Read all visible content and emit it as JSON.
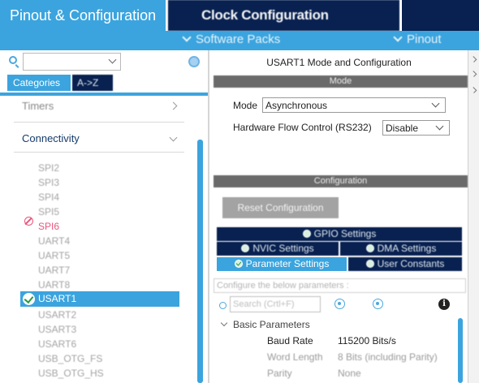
{
  "top_tabs": {
    "pinout": "Pinout & Configuration",
    "clock": "Clock Configuration"
  },
  "subbar": {
    "software_packs": "Software Packs",
    "pinout": "Pinout"
  },
  "left_panel": {
    "tabs": {
      "categories": "Categories",
      "atoz": "A->Z"
    },
    "tree": {
      "timers": "Timers",
      "connectivity": "Connectivity",
      "peripherals": [
        "SPI2",
        "SPI3",
        "SPI4",
        "SPI5",
        "SPI6",
        "UART4",
        "UART5",
        "UART7",
        "UART8",
        "USART1",
        "USART2",
        "USART3",
        "USART6",
        "USB_OTG_FS",
        "USB_OTG_HS"
      ],
      "selected": "USART1",
      "error_item": "SPI6"
    }
  },
  "right_panel": {
    "title": "USART1 Mode and Configuration",
    "mode_section": "Mode",
    "mode_label": "Mode",
    "mode_value": "Asynchronous",
    "hfc_label": "Hardware Flow Control (RS232)",
    "hfc_value": "Disable",
    "config_section": "Configuration",
    "reset_button": "Reset Configuration",
    "subtabs": {
      "gpio": "GPIO Settings",
      "nvic": "NVIC Settings",
      "dma": "DMA Settings",
      "params": "Parameter Settings",
      "user": "User Constants"
    },
    "params_hint": "Configure the below parameters :",
    "search_placeholder": "Search (Crtl+F)",
    "info_icon": "i",
    "basic_group": "Basic Parameters",
    "parameters": [
      {
        "name": "Baud Rate",
        "value": "115200 Bits/s"
      },
      {
        "name": "Word Length",
        "value": "8 Bits (including Parity)"
      },
      {
        "name": "Parity",
        "value": "None"
      }
    ]
  },
  "colors": {
    "accent": "#3ba4de",
    "navy": "#082150",
    "error": "#e8567c",
    "section_gray": "#6a6a6a"
  },
  "icons": [
    "search-icon",
    "gear-icon",
    "chevron-down-icon",
    "chevron-right-icon",
    "check-circle-icon",
    "ban-icon",
    "settings-dot-icon",
    "info-icon"
  ]
}
